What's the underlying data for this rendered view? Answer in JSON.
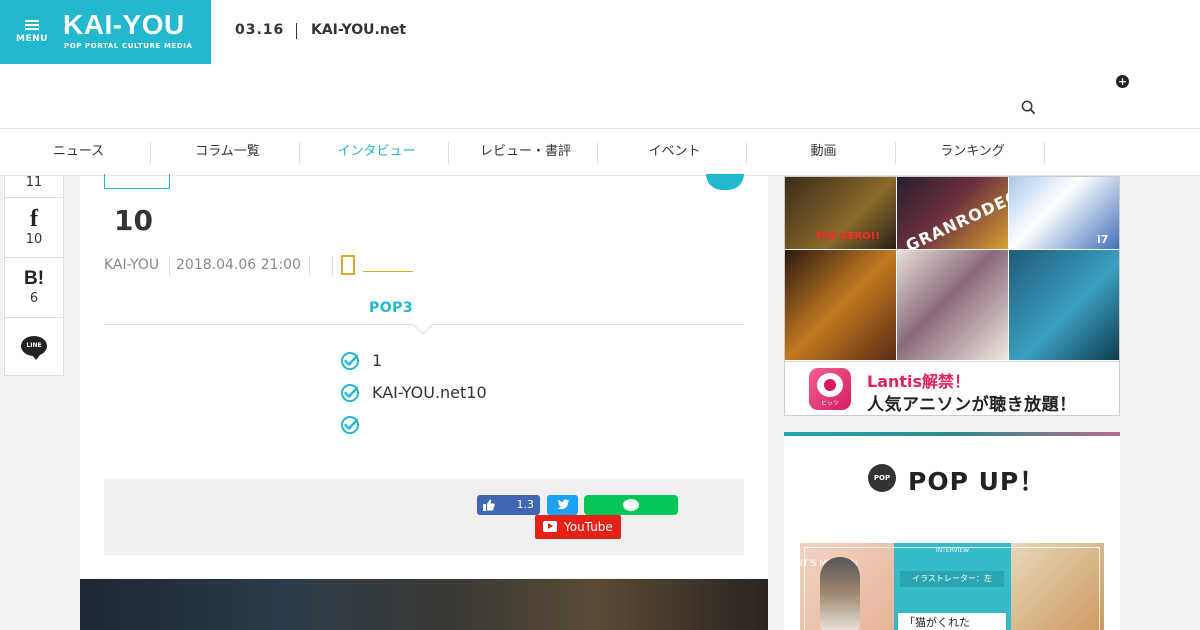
{
  "header": {
    "menu_label": "MENU",
    "logo": "KAI-YOU",
    "logo_sub": "POP PORTAL CULTURE MEDIA",
    "date": "03.16",
    "site_name": "KAI-YOU.net"
  },
  "nav": {
    "items": [
      {
        "label": "ニュース"
      },
      {
        "label": "コラム一覧"
      },
      {
        "label": "インタビュー"
      },
      {
        "label": "レビュー・書評"
      },
      {
        "label": "イベント"
      },
      {
        "label": "動画"
      },
      {
        "label": "ランキング"
      }
    ],
    "active_index": 2
  },
  "share_sidebar": {
    "top_count": "11",
    "facebook_count": "10",
    "hatena_label": "B!",
    "hatena_count": "6",
    "line_label": "LINE"
  },
  "article": {
    "title": "10",
    "author": "KAI-YOU",
    "date": "2018.04.06 21:00",
    "pop_label": "POP3",
    "points": [
      {
        "text": "1"
      },
      {
        "text": "KAI-YOU.net10"
      },
      {
        "text": ""
      }
    ],
    "share": {
      "fb_like_count": "1.3",
      "youtube_label": "YouTube"
    }
  },
  "ad": {
    "tag_zero": "THE ZERO!!",
    "tag_granrodeo": "GRANRODEO",
    "tag_i7": "i7",
    "dhits_label": "ヒッツ",
    "line1": "Lantis解禁！",
    "line2": "人気アニソンが聴き放題！"
  },
  "popup": {
    "badge": "POP",
    "title": "POP UP！",
    "thumb1_tag": "IT'S MISSION",
    "thumb2_head": "INTERVIEW",
    "thumb2_card": "イラストレーター：左",
    "thumb2_text": "「猫がくれた"
  },
  "colors": {
    "brand": "#22b8cd",
    "accent_orange": "#e0a82a",
    "youtube": "#e62117",
    "line": "#06c755",
    "facebook": "#4267b2",
    "twitter": "#1da1f2"
  }
}
